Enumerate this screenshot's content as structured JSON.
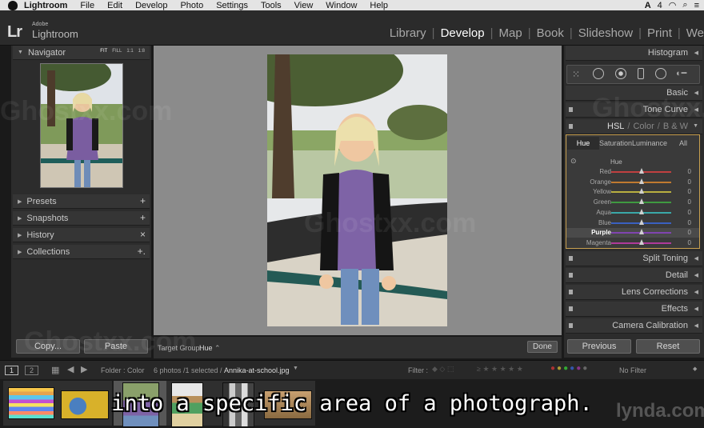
{
  "menubar": {
    "app": "Lightroom",
    "items": [
      "File",
      "Edit",
      "Develop",
      "Photo",
      "Settings",
      "Tools",
      "View",
      "Window",
      "Help"
    ],
    "right": [
      "4"
    ]
  },
  "app": {
    "adobe": "Adobe",
    "name": "Lightroom",
    "lr": "Lr"
  },
  "modules": [
    "Library",
    "Develop",
    "Map",
    "Book",
    "Slideshow",
    "Print",
    "We"
  ],
  "active_module": "Develop",
  "left_panel": {
    "navigator": "Navigator",
    "nav_options": [
      "FIT",
      "FILL",
      "1:1",
      "1:8"
    ],
    "sections": [
      "Presets",
      "Snapshots",
      "History",
      "Collections"
    ],
    "section_actions": [
      "+",
      "+",
      "×",
      "+."
    ],
    "copy": "Copy...",
    "paste": "Paste"
  },
  "toolbar": {
    "target_group_label": "Target Group:",
    "target_group_value": "Hue",
    "done": "Done"
  },
  "right_panel": {
    "histogram": "Histogram",
    "basic": "Basic",
    "tone_curve": "Tone Curve",
    "hsl_header": {
      "hsl": "HSL",
      "color": "Color",
      "bw": "B & W",
      "sep": "/"
    },
    "tabs": [
      "Hue",
      "Saturation",
      "Luminance",
      "All"
    ],
    "sub_title": "Hue",
    "sliders": [
      {
        "label": "Red",
        "value": "0",
        "color": "#c04040"
      },
      {
        "label": "Orange",
        "value": "0",
        "color": "#c07a30"
      },
      {
        "label": "Yellow",
        "value": "0",
        "color": "#b9b040"
      },
      {
        "label": "Green",
        "value": "0",
        "color": "#3f9a40"
      },
      {
        "label": "Aqua",
        "value": "0",
        "color": "#3aa9a9"
      },
      {
        "label": "Blue",
        "value": "0",
        "color": "#3a60c0"
      },
      {
        "label": "Purple",
        "value": "0",
        "color": "#8044b0"
      },
      {
        "label": "Magenta",
        "value": "0",
        "color": "#b03a9a"
      }
    ],
    "split_toning": "Split Toning",
    "detail": "Detail",
    "lens_corrections": "Lens Corrections",
    "effects": "Effects",
    "camera_calibration": "Camera Calibration",
    "previous": "Previous",
    "reset": "Reset"
  },
  "filmstrip_bar": {
    "page1": "1",
    "page2": "2",
    "source": "Folder : Color",
    "count": "6 photos /1 selected /",
    "filename": "Annika-at-school.jpg",
    "filter_label": "Filter :",
    "filter_value": "No Filter"
  },
  "caption": "into a specific area of a photograph.",
  "watermark": [
    "Ghostxx.com",
    "lynda.com"
  ]
}
